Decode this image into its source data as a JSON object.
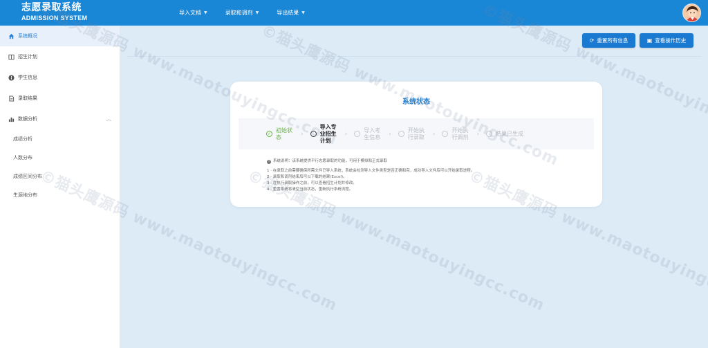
{
  "header": {
    "title": "志愿录取系统",
    "subtitle": "ADMISSION SYSTEM",
    "nav": [
      {
        "label": "导入文档"
      },
      {
        "label": "录取和调剂"
      },
      {
        "label": "导出结果"
      }
    ]
  },
  "sidebar": {
    "items": [
      {
        "label": "系统概况",
        "icon": "home-icon"
      },
      {
        "label": "招生计划",
        "icon": "book-icon"
      },
      {
        "label": "学生信息",
        "icon": "info-icon"
      },
      {
        "label": "录取结果",
        "icon": "document-icon"
      },
      {
        "label": "数据分析",
        "icon": "bar-chart-icon"
      }
    ],
    "sub_items": [
      {
        "label": "成绩分析"
      },
      {
        "label": "人数分布"
      },
      {
        "label": "成绩区间分布"
      },
      {
        "label": "生源地分布"
      }
    ]
  },
  "actions": {
    "reset_label": "重置所有信息",
    "history_label": "查看操作历史"
  },
  "status_card": {
    "title": "系统状态",
    "steps": [
      {
        "label": "初始状态",
        "state": "done"
      },
      {
        "label": "导入专业招生计划",
        "state": "current"
      },
      {
        "label": "导入考生信息",
        "state": "pending"
      },
      {
        "label": "开始执行录取",
        "state": "pending"
      },
      {
        "label": "开始执行调剂",
        "state": "pending"
      },
      {
        "label": "结果已生成",
        "state": "pending"
      }
    ],
    "description_title": "系统说明：该系统提供平行志愿录取的功能，可用于模拟和正式录取",
    "description_lines": [
      "1 · 在录取之前需要确保所需文件已导入系统，系统会检测导入文件类型是否正确和完，成功导入文件后可以开始录取进程。",
      "2 · 录取和调剂结束后可以下载的结果(Excel)。",
      "3 · 在执行录取操作之前，可以查看招生计划并修改。",
      "4 · 重置系统将清空当前状态，重新执行系统流程。"
    ]
  },
  "watermark": "©猫头鹰源码 www.maotouyingcc.com",
  "colors": {
    "primary": "#1a86d6",
    "button": "#1a79d1",
    "background": "#ddebf7",
    "done": "#5fb338"
  }
}
